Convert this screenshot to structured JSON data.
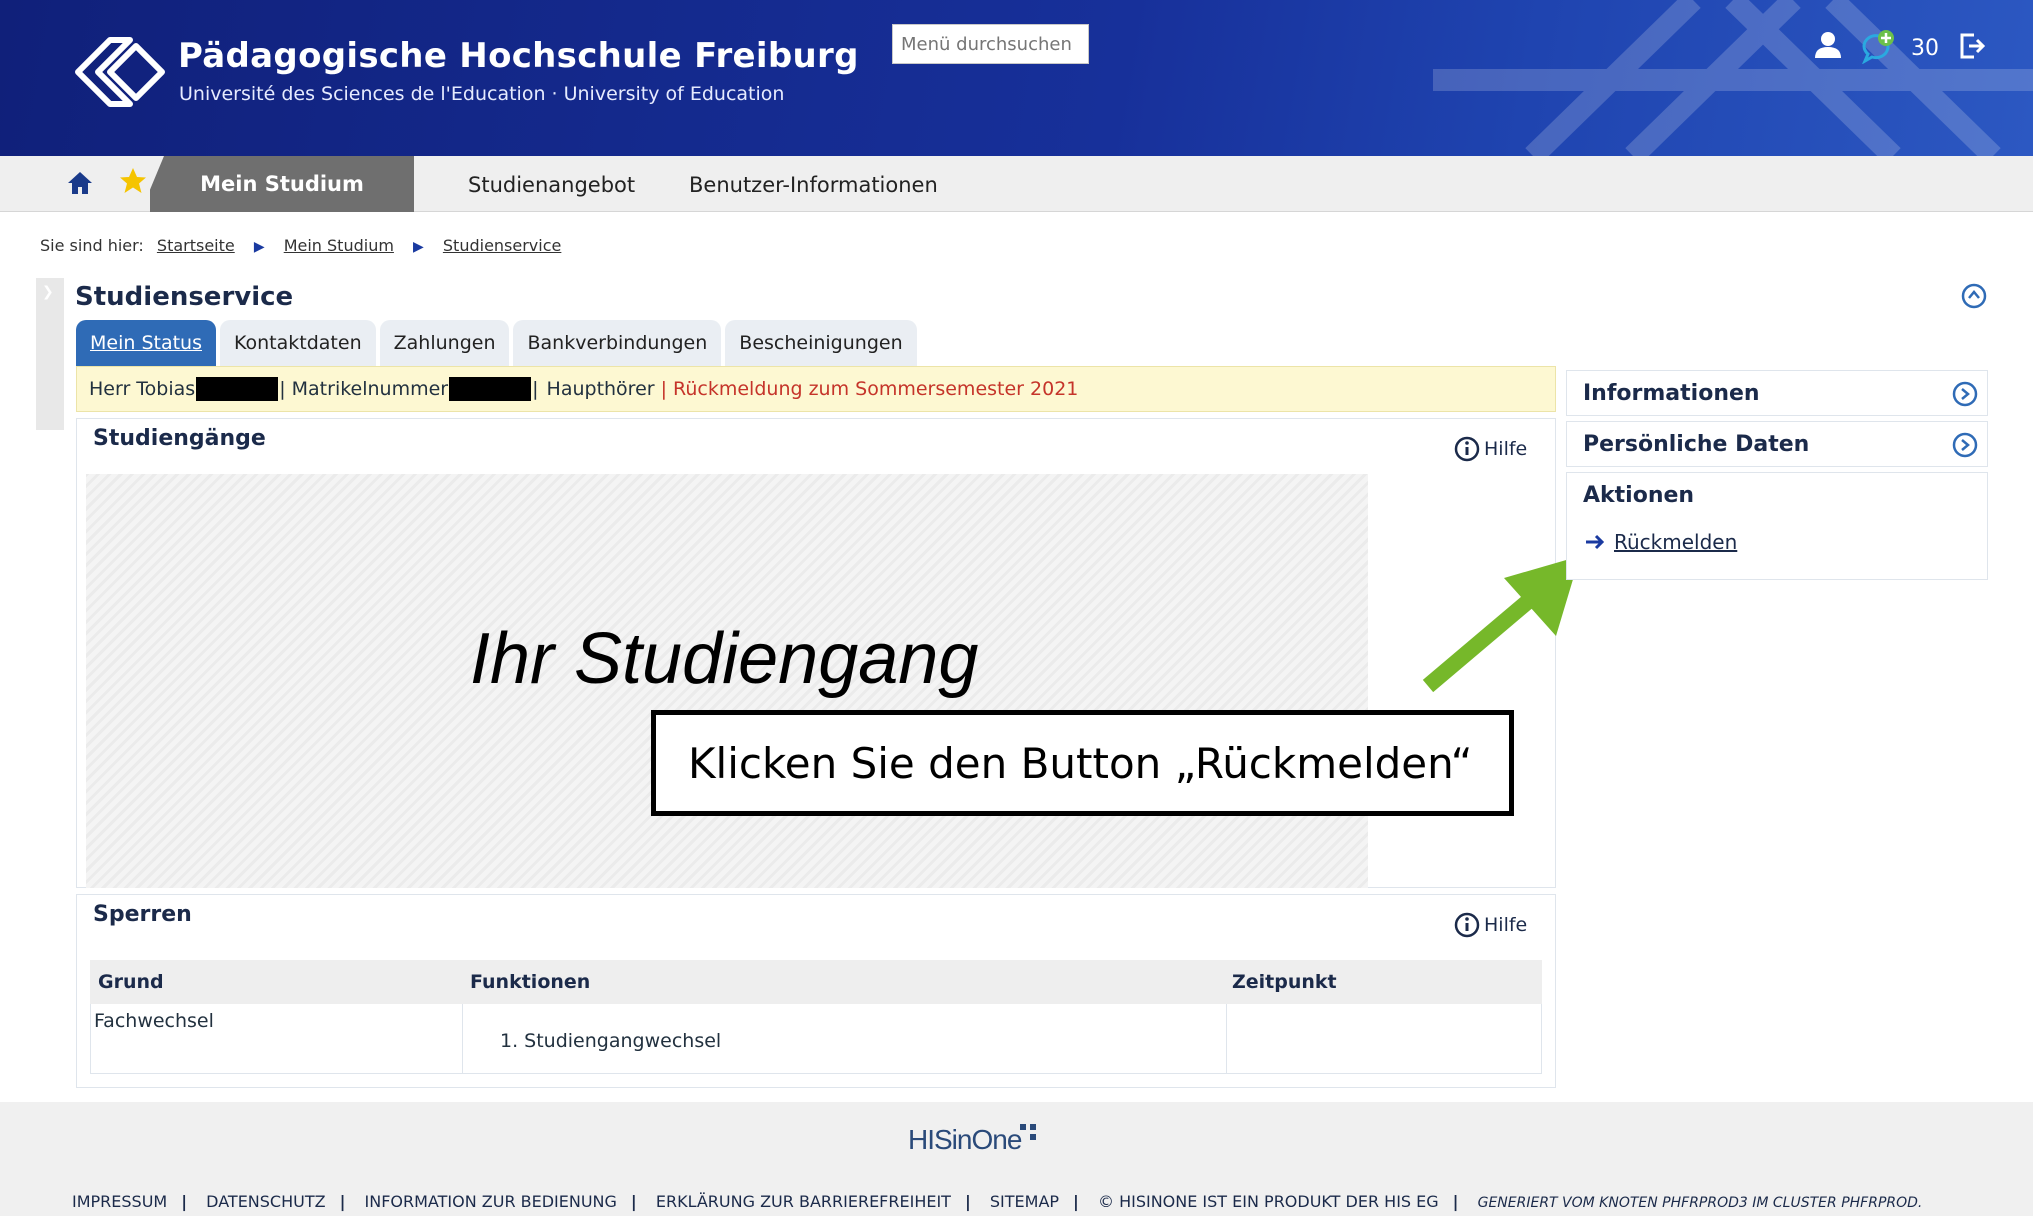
{
  "header": {
    "title": "Pädagogische Hochschule Freiburg",
    "subtitle": "Université des Sciences de l'Education · University of Education",
    "search_placeholder": "Menü durchsuchen",
    "message_count": "30",
    "icons": [
      "user-icon",
      "messages-icon",
      "logout-icon"
    ]
  },
  "nav": {
    "icons": [
      "home-icon",
      "favorites-star-icon"
    ],
    "active": "Mein Studium",
    "items": [
      "Studienangebot",
      "Benutzer-Informationen"
    ]
  },
  "breadcrumb": {
    "prefix": "Sie sind hier:",
    "items": [
      "Startseite",
      "Mein Studium",
      "Studienservice"
    ]
  },
  "page": {
    "title": "Studienservice"
  },
  "tabs": [
    "Mein Status",
    "Kontaktdaten",
    "Zahlungen",
    "Bankverbindungen",
    "Bescheinigungen"
  ],
  "status": {
    "name": "Herr Tobias",
    "matrikel": "| Matrikelnummer",
    "sep": "|",
    "type": "Haupthörer",
    "notice": "| Rückmeldung zum Sommersemester 2021"
  },
  "studiengaenge": {
    "title": "Studiengänge",
    "help": "Hilfe",
    "overlay_text": "Ihr Studiengang"
  },
  "callout": {
    "text": "Klicken Sie den Button „Rückmelden“"
  },
  "sperren": {
    "title": "Sperren",
    "help": "Hilfe",
    "columns": [
      "Grund",
      "Funktionen",
      "Zeitpunkt"
    ],
    "rows": [
      {
        "grund": "Fachwechsel",
        "funktionen": "1. Studiengangwechsel",
        "zeitpunkt": ""
      }
    ]
  },
  "sidebar": {
    "informationen": "Informationen",
    "persoenliche_daten": "Persönliche Daten",
    "aktionen": "Aktionen",
    "action_link": "Rückmelden"
  },
  "colors": {
    "header_blue": "#17309a",
    "tab_active": "#2f6bb6",
    "status_bg": "#fdf8d2",
    "notice_red": "#c5342a",
    "arrow_green": "#76b82a"
  },
  "footer": {
    "logo": "HISinOne",
    "links": [
      "IMPRESSUM",
      "DATENSCHUTZ",
      "INFORMATION ZUR BEDIENUNG",
      "ERKLÄRUNG ZUR BARRIEREFREIHEIT",
      "SITEMAP",
      "© HISINONE IST EIN PRODUKT DER HIS EG"
    ],
    "generated": "GENERIERT VOM KNOTEN PHFRPROD3 IM CLUSTER PHFRPROD."
  }
}
